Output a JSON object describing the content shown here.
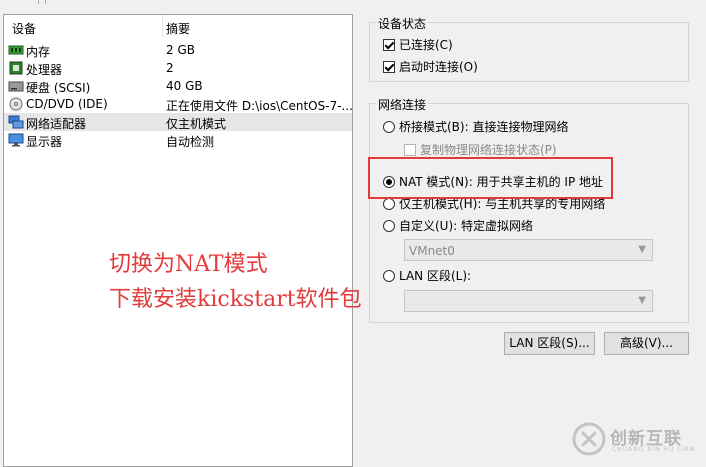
{
  "device_list": {
    "col_device": "设备",
    "col_summary": "摘要",
    "rows": [
      {
        "name": "内存",
        "summary": "2 GB",
        "icon": "memory-icon"
      },
      {
        "name": "处理器",
        "summary": "2",
        "icon": "processor-icon"
      },
      {
        "name": "硬盘 (SCSI)",
        "summary": "40 GB",
        "icon": "hard-disk-icon"
      },
      {
        "name": "CD/DVD (IDE)",
        "summary": "正在使用文件 D:\\ios\\CentOS-7-...",
        "icon": "cd-dvd-icon"
      },
      {
        "name": "网络适配器",
        "summary": "仅主机模式",
        "icon": "network-adapter-icon",
        "selected": true
      },
      {
        "name": "显示器",
        "summary": "自动检测",
        "icon": "display-icon"
      }
    ]
  },
  "device_status": {
    "title": "设备状态",
    "connected": {
      "label": "已连接(C)",
      "checked": true
    },
    "connect_on_power": {
      "label": "启动时连接(O)",
      "checked": true
    }
  },
  "network": {
    "title": "网络连接",
    "bridged": {
      "label": "桥接模式(B): 直接连接物理网络",
      "checked": false
    },
    "replicate": {
      "label": "复制物理网络连接状态(P)",
      "checked": false
    },
    "nat": {
      "label": "NAT 模式(N): 用于共享主机的 IP 地址",
      "checked": true
    },
    "host_only": {
      "label": "仅主机模式(H): 与主机共享的专用网络",
      "checked": false
    },
    "custom": {
      "label": "自定义(U): 特定虚拟网络",
      "checked": false
    },
    "custom_select": "VMnet0",
    "lan": {
      "label": "LAN 区段(L):",
      "checked": false
    },
    "lan_select": ""
  },
  "buttons": {
    "lan_segments": "LAN 区段(S)...",
    "advanced": "高级(V)..."
  },
  "annotation": {
    "line1": "切换为NAT模式",
    "line2": "下载安装kickstart软件包"
  },
  "watermark": {
    "brand": "创新互联",
    "sub": "CHUANG XIN HU LIAN"
  },
  "colors": {
    "highlight": "#e23a3a",
    "annotation": "#e33b3b"
  }
}
